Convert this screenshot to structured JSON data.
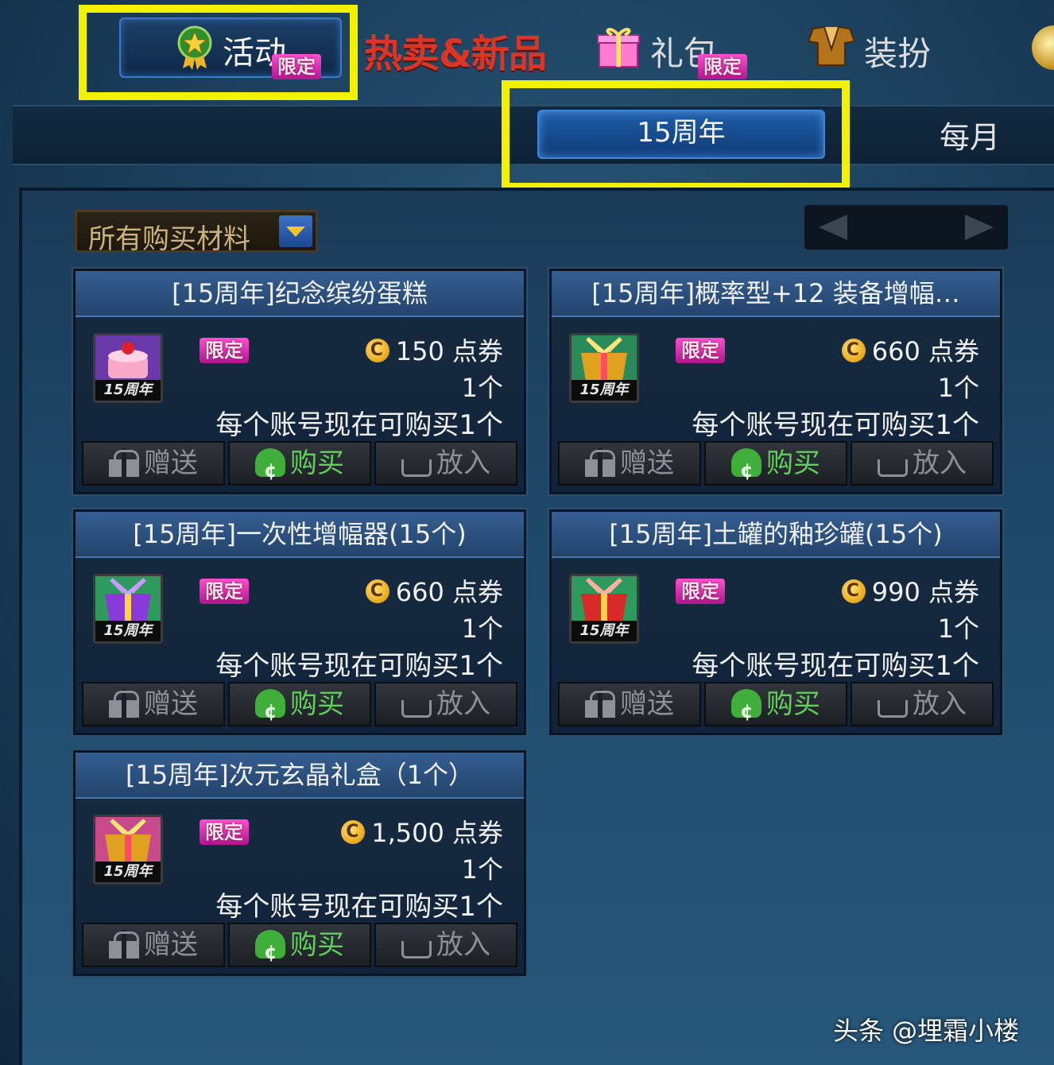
{
  "nav": {
    "tabs": [
      {
        "label": "活动",
        "tag": "限定"
      },
      {
        "label": "热卖&新品"
      },
      {
        "label": "礼包",
        "tag": "限定"
      },
      {
        "label": "装扮"
      }
    ]
  },
  "subnav": {
    "active": "15周年",
    "other": "每月"
  },
  "filter": {
    "label": "所有购买材料"
  },
  "items": [
    {
      "title": "[15周年]纪念缤纷蛋糕",
      "tag": "限定",
      "price": "150",
      "currency": "点券",
      "qty": "1个",
      "limit": "每个账号现在可购买1个",
      "badge": "15周年",
      "art": "cake"
    },
    {
      "title": "[15周年]概率型+12 装备增幅…",
      "tag": "限定",
      "price": "660",
      "currency": "点券",
      "qty": "1个",
      "limit": "每个账号现在可购买1个",
      "badge": "15周年",
      "art": "gold-box"
    },
    {
      "title": "[15周年]一次性增幅器(15个)",
      "tag": "限定",
      "price": "660",
      "currency": "点券",
      "qty": "1个",
      "limit": "每个账号现在可购买1个",
      "badge": "15周年",
      "art": "purple-box"
    },
    {
      "title": "[15周年]土罐的釉珍罐(15个)",
      "tag": "限定",
      "price": "990",
      "currency": "点券",
      "qty": "1个",
      "limit": "每个账号现在可购买1个",
      "badge": "15周年",
      "art": "red-box"
    },
    {
      "title": "[15周年]次元玄晶礼盒（1个）",
      "tag": "限定",
      "price": "1,500",
      "currency": "点券",
      "qty": "1个",
      "limit": "每个账号现在可购买1个",
      "badge": "15周年",
      "art": "gold-box"
    }
  ],
  "buttons": {
    "gift": "赠送",
    "buy": "购买",
    "cart": "放入"
  },
  "watermark": "头条 @埋霜小楼",
  "colors": {
    "highlight": "#f4f100",
    "hot_tab": "#d93628",
    "buy_green": "#5fd05a",
    "limited_pink": "#ff4fd0"
  }
}
